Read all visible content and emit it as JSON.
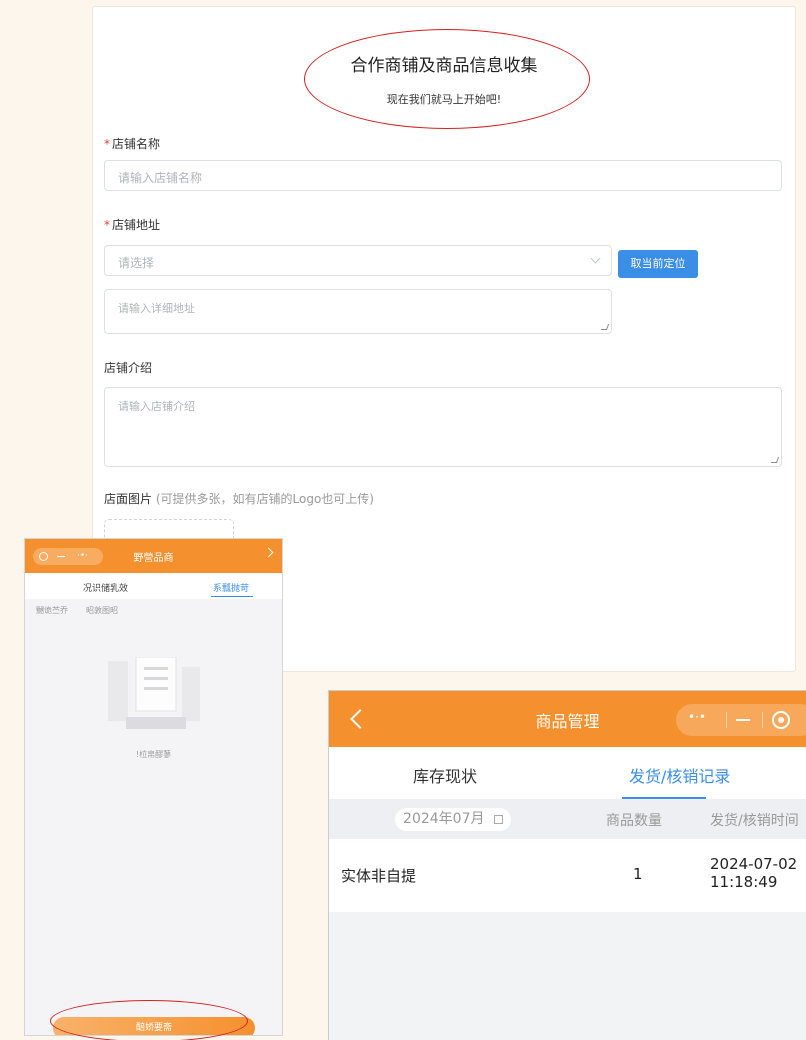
{
  "form": {
    "title": "合作商铺及商品信息收集",
    "subtitle": "现在我们就马上开始吧!",
    "shop_name": {
      "required_mark": "*",
      "label": "店铺名称",
      "placeholder": "请输入店铺名称"
    },
    "shop_address": {
      "required_mark": "*",
      "label": "店铺地址",
      "select_placeholder": "请选择",
      "locate_button": "取当前定位",
      "detail_placeholder": "请输入详细地址"
    },
    "shop_intro": {
      "label": "店铺介绍",
      "placeholder": "请输入店铺介绍"
    },
    "shop_images": {
      "label": "店面图片",
      "hint": "(可提供多张，如有店铺的Logo也可上传)"
    }
  },
  "phone_left": {
    "capsule_dots": "·•·",
    "title": "野營品商",
    "tabs": [
      "况识储乳效",
      "系瓢抛苛"
    ],
    "sub_items": [
      "嬲诡苎乔",
      "昭敦图昭"
    ],
    "empty_text": "!柆帛醪蓼",
    "bottom_button": "醅娇要斋"
  },
  "phone_right": {
    "title": "商品管理",
    "capsule_dots": "•·•",
    "tabs": [
      "库存现状",
      "发货/核销记录"
    ],
    "date_filter": "2024年07月",
    "columns": [
      "商品数量",
      "发货/核销时间"
    ],
    "rows": [
      {
        "name": "实体非自提",
        "quantity": "1",
        "time_date": "2024-07-02",
        "time_clock": "11:18:49"
      }
    ]
  },
  "colors": {
    "accent_orange": "#f5902e",
    "link_blue": "#3a8ee6",
    "annotation_red": "#d42020",
    "required_red": "#e2443a"
  }
}
